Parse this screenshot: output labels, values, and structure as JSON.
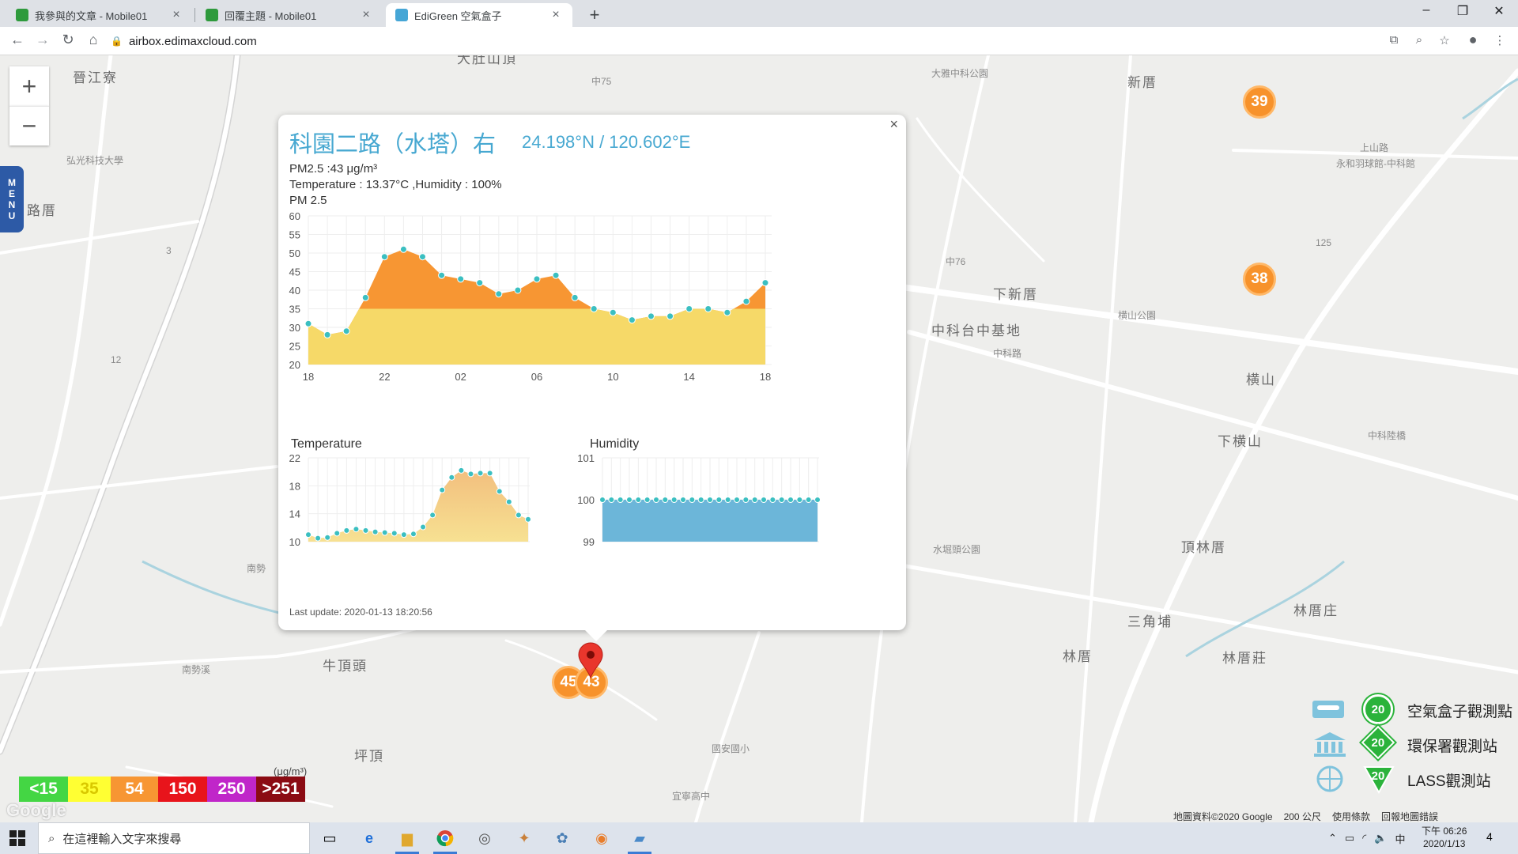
{
  "browser": {
    "tabs": [
      {
        "title": "我參與的文章 - Mobile01",
        "fav_color": "#2e9a3c"
      },
      {
        "title": "回覆主題 - Mobile01",
        "fav_color": "#2e9a3c"
      },
      {
        "title": "EdiGreen 空氣盒子",
        "fav_color": "#46a6d6"
      }
    ],
    "url": "airbox.edimaxcloud.com"
  },
  "map": {
    "places": [
      "晉江寮",
      "大肚山頂",
      "大雅中科公園",
      "新厝",
      "下新厝",
      "中科台中基地",
      "横山",
      "下横山",
      "頂林厝",
      "三角埔",
      "林厝庄",
      "林厝",
      "林厝莊",
      "水堀頭公園",
      "横山公園",
      "牛頂頭",
      "坪頂",
      "路厝",
      "弘光科技大學",
      "國安國小",
      "宜寧高中",
      "南勢",
      "南勢溪"
    ],
    "road_labels": [
      "中75",
      "中76",
      "125",
      "12",
      "3",
      "上山路",
      "中科路",
      "永和羽球館-中科館",
      "中科陸橋"
    ],
    "clusters": [
      {
        "value": "39"
      },
      {
        "value": "38"
      },
      {
        "value": "45"
      },
      {
        "value": "43"
      }
    ],
    "zoom_in": "+",
    "zoom_out": "−",
    "menu_letters": [
      "M",
      "E",
      "N",
      "U"
    ],
    "footer": {
      "map_data": "地圖資料©2020 Google",
      "scale": "200 公尺",
      "terms": "使用條款",
      "report": "回報地圖錯誤"
    },
    "google_logo": "Google"
  },
  "popup": {
    "site_name": "科園二路（水塔）右",
    "coords": "24.198°N / 120.602°E",
    "pm_line": "PM2.5 :43 μg/m³",
    "temp_hum_line": "Temperature : 13.37°C ,Humidity : 100%",
    "chart_title": "PM 2.5",
    "temperature_title": "Temperature",
    "humidity_title": "Humidity",
    "last_update": "Last update: 2020-01-13 18:20:56",
    "close": "×"
  },
  "chart_data": [
    {
      "type": "area",
      "title": "PM 2.5",
      "x_tick_labels": [
        "18",
        "22",
        "02",
        "06",
        "10",
        "14",
        "18"
      ],
      "ylim": [
        20,
        60
      ],
      "y_ticks": [
        60,
        55,
        50,
        45,
        40,
        35,
        30,
        25,
        20
      ],
      "threshold_band": 35,
      "colors": {
        "above": "#f79633",
        "below": "#f6d968",
        "point": "#3bbfc1"
      },
      "values": [
        31,
        28,
        29,
        38,
        49,
        51,
        49,
        44,
        43,
        42,
        39,
        40,
        43,
        44,
        38,
        35,
        34,
        32,
        33,
        33,
        35,
        35,
        34,
        37,
        42
      ]
    },
    {
      "type": "area",
      "title": "Temperature",
      "ylim": [
        10,
        22
      ],
      "y_ticks": [
        22,
        18,
        14,
        10
      ],
      "colors": {
        "fill_top": "#f2bf7e",
        "fill_bottom": "#f7e192",
        "point": "#3bbfc1"
      },
      "values": [
        11.0,
        10.5,
        10.6,
        11.2,
        11.6,
        11.8,
        11.6,
        11.4,
        11.3,
        11.2,
        11.0,
        11.1,
        12.1,
        13.8,
        17.4,
        19.2,
        20.2,
        19.7,
        19.8,
        19.8,
        17.2,
        15.7,
        13.8,
        13.2
      ]
    },
    {
      "type": "area",
      "title": "Humidity",
      "ylim": [
        99,
        101
      ],
      "y_ticks": [
        101,
        100,
        99
      ],
      "colors": {
        "fill": "#6cb6d9",
        "point": "#3bbfc1"
      },
      "values": [
        100,
        100,
        100,
        100,
        100,
        100,
        100,
        100,
        100,
        100,
        100,
        100,
        100,
        100,
        100,
        100,
        100,
        100,
        100,
        100,
        100,
        100,
        100,
        100,
        100
      ]
    }
  ],
  "pm_scale": {
    "unit": "(μg/m³)",
    "levels": [
      {
        "label": "<15",
        "color": "#44d644",
        "text": "#ffffff"
      },
      {
        "label": "35",
        "color": "#ffff33",
        "text": "#d9c800"
      },
      {
        "label": "54",
        "color": "#f79633",
        "text": "#ffffff"
      },
      {
        "label": "150",
        "color": "#e8141b",
        "text": "#ffffff"
      },
      {
        "label": "250",
        "color": "#c026c9",
        "text": "#ffffff"
      },
      {
        "label": ">251",
        "color": "#8b0b13",
        "text": "#ffffff"
      }
    ]
  },
  "station_legend": [
    {
      "badge": "20",
      "label": "空氣盒子觀測點",
      "icon": "airbox-icon"
    },
    {
      "badge": "20",
      "label": "環保署觀測站",
      "icon": "government-building-icon"
    },
    {
      "badge": "20",
      "label": "LASS觀測站",
      "icon": "lass-globe-icon"
    }
  ],
  "taskbar": {
    "search_placeholder": "在這裡輸入文字來搜尋",
    "time": "下午 06:26",
    "date": "2020/1/13",
    "ime": "中",
    "notifications": "4"
  }
}
